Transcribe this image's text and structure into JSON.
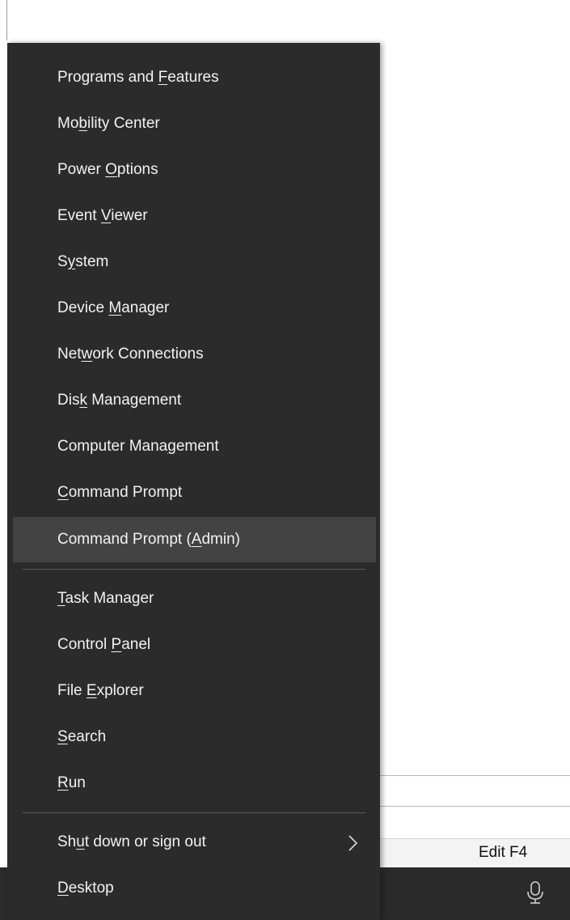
{
  "menu": {
    "group1": [
      {
        "pre": "Programs and ",
        "ul": "F",
        "post": "eatures"
      },
      {
        "pre": "Mo",
        "ul": "b",
        "post": "ility Center"
      },
      {
        "pre": "Power ",
        "ul": "O",
        "post": "ptions"
      },
      {
        "pre": "Event ",
        "ul": "V",
        "post": "iewer"
      },
      {
        "pre": "S",
        "ul": "y",
        "post": "stem"
      },
      {
        "pre": "Device ",
        "ul": "M",
        "post": "anager"
      },
      {
        "pre": "Net",
        "ul": "w",
        "post": "ork Connections"
      },
      {
        "pre": "Dis",
        "ul": "k",
        "post": " Management"
      },
      {
        "pre": "Computer Mana",
        "ul": "g",
        "post": "ement"
      },
      {
        "pre": "",
        "ul": "C",
        "post": "ommand Prompt"
      },
      {
        "pre": "Command Prompt (",
        "ul": "A",
        "post": "dmin)"
      }
    ],
    "group2": [
      {
        "pre": "",
        "ul": "T",
        "post": "ask Manager"
      },
      {
        "pre": "Control ",
        "ul": "P",
        "post": "anel"
      },
      {
        "pre": "File ",
        "ul": "E",
        "post": "xplorer"
      },
      {
        "pre": "",
        "ul": "S",
        "post": "earch"
      },
      {
        "pre": "",
        "ul": "R",
        "post": "un"
      }
    ],
    "group3": [
      {
        "pre": "Sh",
        "ul": "u",
        "post": "t down or sign out"
      },
      {
        "pre": "",
        "ul": "D",
        "post": "esktop"
      }
    ],
    "highlighted_item": "Command Prompt (Admin)",
    "submenu_icon": "chevron-right-icon"
  },
  "background": {
    "status_text": "Edit F4",
    "taskbar_icon": "microphone-icon"
  },
  "colors": {
    "menu_bg": "#2b2b2b",
    "menu_hover": "#434343",
    "menu_text": "#f2f2f2",
    "taskbar_bg": "#2a2a2a"
  }
}
